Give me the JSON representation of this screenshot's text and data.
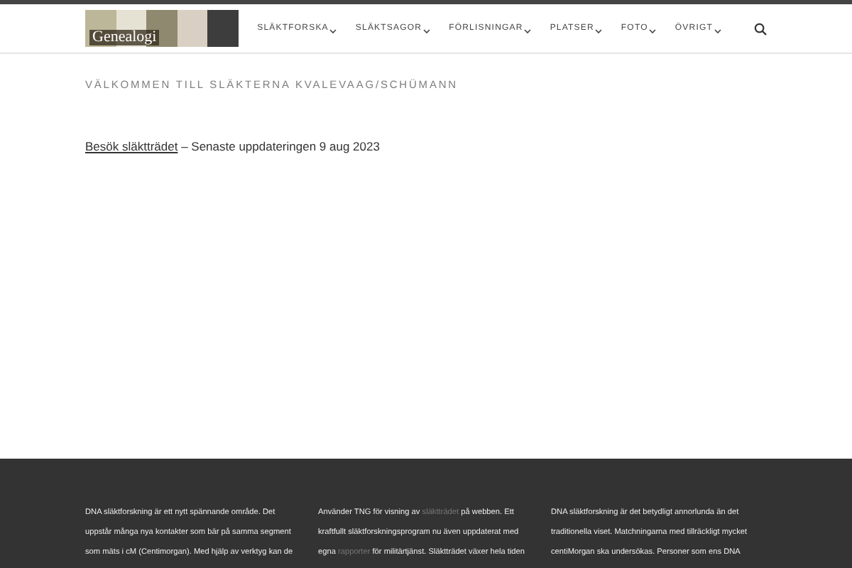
{
  "logo": {
    "text": "Genealogi"
  },
  "nav": [
    {
      "label": "SLÄKTFORSKA"
    },
    {
      "label": "SLÄKTSAGOR"
    },
    {
      "label": "FÖRLISNINGAR"
    },
    {
      "label": "PLATSER"
    },
    {
      "label": "FOTO"
    },
    {
      "label": "ÖVRIGT"
    }
  ],
  "page_title": "VÄLKOMMEN TILL SLÄKTERNA KVALEVAAG/SCHÜMANN",
  "intro": {
    "link": "Besök släktträdet",
    "text": " – Senaste uppdateringen 9 aug 2023"
  },
  "footer": [
    {
      "segments": [
        {
          "kind": "text",
          "text": "DNA släktforskning är ett nytt spännande område. Det\nuppstår många nya kontakter som bär på samma segment\nsom mäts i cM (Centimorgan). Med hjälp av verktyg kan de"
        }
      ]
    },
    {
      "segments": [
        {
          "kind": "text",
          "text": "Använder TNG för visning av "
        },
        {
          "kind": "link",
          "text": "släktträdet"
        },
        {
          "kind": "text",
          "text": " på webben. Ett\nkraftfullt släktforskningsprogram nu även uppdaterat med\negna "
        },
        {
          "kind": "link",
          "text": "rapporter"
        },
        {
          "kind": "text",
          "text": " för militärtjänst. Släktträdet växer hela tiden"
        }
      ]
    },
    {
      "segments": [
        {
          "kind": "text",
          "text": "DNA släktforskning är det betydligt annorlunda än det\ntraditionella viset. Matchningarna med tillräckligt mycket\ncentiMorgan ska undersökas. Personer som ens DNA"
        }
      ]
    }
  ]
}
